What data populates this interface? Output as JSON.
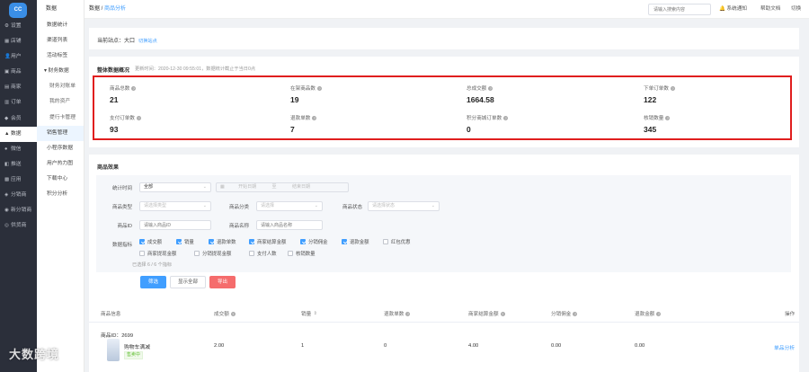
{
  "app": {
    "logo_text": "CC"
  },
  "nav": [
    {
      "icon": "⚙",
      "label": "设置"
    },
    {
      "icon": "▦",
      "label": "店铺"
    },
    {
      "icon": "👤",
      "label": "用户"
    },
    {
      "icon": "▣",
      "label": "商品"
    },
    {
      "icon": "▤",
      "label": "商家"
    },
    {
      "icon": "▥",
      "label": "订单"
    },
    {
      "icon": "◆",
      "label": "会员"
    },
    {
      "icon": "▲",
      "label": "数据",
      "active": true
    },
    {
      "icon": "●",
      "label": "微信"
    },
    {
      "icon": "◧",
      "label": "推送"
    },
    {
      "icon": "▩",
      "label": "应用"
    },
    {
      "icon": "◈",
      "label": "分销商"
    },
    {
      "icon": "◉",
      "label": "新分销商"
    },
    {
      "icon": "◎",
      "label": "供货商"
    }
  ],
  "subnav": {
    "title": "数据",
    "items": [
      {
        "label": "数据统计",
        "kind": "item"
      },
      {
        "label": "渠道列表",
        "kind": "item"
      },
      {
        "label": "活动标签",
        "kind": "item"
      },
      {
        "label": "▾ 财务数据",
        "kind": "group"
      },
      {
        "label": "财务对账单",
        "kind": "sub"
      },
      {
        "label": "我的资产",
        "kind": "sub"
      },
      {
        "label": "提行卡管理",
        "kind": "sub"
      },
      {
        "label": "销售管理",
        "kind": "item",
        "selected": true
      },
      {
        "label": "小程序数据",
        "kind": "item"
      },
      {
        "label": "用户热力图",
        "kind": "item"
      },
      {
        "label": "下载中心",
        "kind": "item"
      },
      {
        "label": "积分分析",
        "kind": "item"
      }
    ]
  },
  "topbar": {
    "breadcrumb_root": "数据",
    "breadcrumb_sep": " / ",
    "breadcrumb_current": "商品分析",
    "search_placeholder": "请输入搜索内容",
    "notice": "系统通知",
    "help": "帮助文档",
    "more": "切换"
  },
  "station": {
    "label": "当前站点：大口",
    "switch": "切换站点"
  },
  "overview": {
    "title": "整体数据概况",
    "updated": "更新时间：2020-12-30 09:55:01，数据统计截止于当日0点",
    "metrics": [
      {
        "label": "商品总数",
        "value": "21"
      },
      {
        "label": "在架商品数",
        "value": "19"
      },
      {
        "label": "总成交额",
        "value": "1664.58"
      },
      {
        "label": "下单订单数",
        "value": "122"
      },
      {
        "label": "支付订单数",
        "value": "93"
      },
      {
        "label": "退款单数",
        "value": "7"
      },
      {
        "label": "积分商城订单数",
        "value": "0"
      },
      {
        "label": "核销数量",
        "value": "345"
      }
    ]
  },
  "effect": {
    "title": "商品效果",
    "filters": {
      "time_label": "统计时间",
      "time_value": "全部",
      "date_sep": "至",
      "date_start": "开始日期",
      "date_end": "结束日期",
      "type_label": "商品类型",
      "type_placeholder": "请选择类型",
      "category_label": "商品分类",
      "category_placeholder": "请选择",
      "status_label": "商品状态",
      "status_placeholder": "请选择状态",
      "id_label": "商品ID",
      "id_placeholder": "请输入商品ID",
      "name_label": "商品名称",
      "name_placeholder": "请输入商品名称",
      "metric_label": "数据指标"
    },
    "checkboxes_row1": [
      {
        "label": "成交额",
        "checked": true
      },
      {
        "label": "销量",
        "checked": true
      },
      {
        "label": "退款单数",
        "checked": true
      },
      {
        "label": "商家结算金额",
        "checked": true
      },
      {
        "label": "分销佣金",
        "checked": true
      },
      {
        "label": "退款金额",
        "checked": true
      },
      {
        "label": "红包优惠",
        "checked": false
      }
    ],
    "checkboxes_row2": [
      {
        "label": "商家提现金额",
        "checked": false
      },
      {
        "label": "分销提现金额",
        "checked": false
      },
      {
        "label": "支付人数",
        "checked": false
      },
      {
        "label": "核销数量",
        "checked": false
      }
    ],
    "selected_count": "已选择 6 / 6 个指标",
    "buttons": {
      "filter": "筛选",
      "show_all": "显示全部",
      "export": "导出"
    },
    "table": {
      "headers": [
        "商品信息",
        "成交额",
        "销量",
        "退款单数",
        "商家结算金额",
        "分销佣金",
        "退款金额",
        "操作"
      ],
      "rows": [
        {
          "id": "商品ID：2699",
          "name": "购物车满减",
          "status": "售卖中",
          "amount": "2.00",
          "sales": "1",
          "refunds": "0",
          "settle": "4.00",
          "commission": "0.00",
          "refund_amount": "0.00",
          "action": "单品分析"
        }
      ]
    }
  },
  "watermark": "大数跨境",
  "colors": {
    "accent": "#409eff",
    "highlight": "#e01e1e",
    "nav_bg": "#2b2f3a"
  }
}
